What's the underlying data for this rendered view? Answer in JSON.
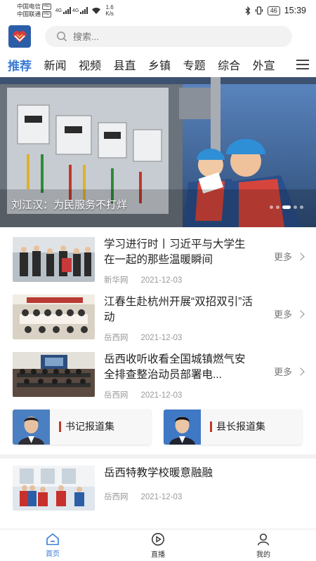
{
  "status_bar": {
    "carrier1": "中国电信",
    "carrier2": "中国联通",
    "hd": "HD",
    "net1": "4G",
    "net2": "4G",
    "speed_value": "1.6",
    "speed_unit": "K/s",
    "battery": "46",
    "time": "15:39"
  },
  "header": {
    "search_placeholder": "搜索..."
  },
  "tabs": [
    "推荐",
    "新闻",
    "视频",
    "县直",
    "乡镇",
    "专题",
    "综合",
    "外宣"
  ],
  "active_tab": "推荐",
  "banner": {
    "caption": "刘江汉：为民服务不打烊",
    "slide_count": 5,
    "active_slide": 3
  },
  "news": [
    {
      "title": "学习进行时丨习近平与大学生在一起的那些温暖瞬间",
      "source": "新华网",
      "date": "2021-12-03",
      "more": "更多"
    },
    {
      "title": "江春生赴杭州开展“双招双引”活动",
      "source": "岳西网",
      "date": "2021-12-03",
      "more": "更多"
    },
    {
      "title": "岳西收听收看全国城镇燃气安全排查整治动员部署电...",
      "source": "岳西网",
      "date": "2021-12-03",
      "more": "更多"
    }
  ],
  "reports": {
    "secretary": "书记报道集",
    "county_head": "县长报道集"
  },
  "news2": [
    {
      "title": "岳西特教学校暖意融融",
      "source": "岳西网",
      "date": "2021-12-03"
    }
  ],
  "bottom_nav": {
    "home": "首页",
    "live": "直播",
    "mine": "我的"
  },
  "colors": {
    "accent": "#3a7bd5",
    "report_bar": "#c0392b"
  }
}
